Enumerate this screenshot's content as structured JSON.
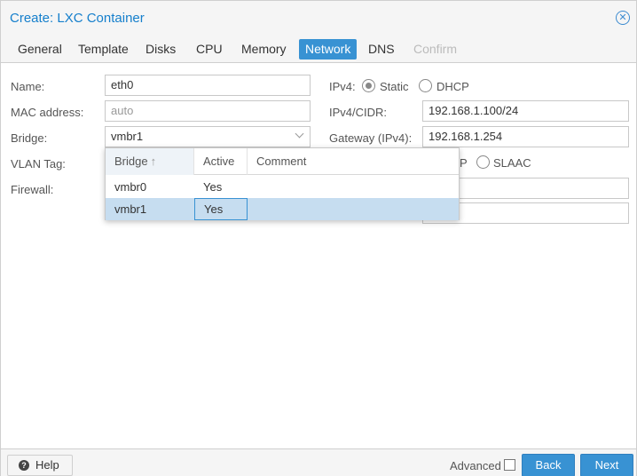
{
  "window": {
    "title": "Create: LXC Container"
  },
  "tabs": [
    {
      "label": "General"
    },
    {
      "label": "Template"
    },
    {
      "label": "Disks"
    },
    {
      "label": "CPU"
    },
    {
      "label": "Memory"
    },
    {
      "label": "Network",
      "active": true
    },
    {
      "label": "DNS"
    },
    {
      "label": "Confirm",
      "disabled": true
    }
  ],
  "form_left": {
    "name_label": "Name:",
    "name_value": "eth0",
    "mac_label": "MAC address:",
    "mac_placeholder": "auto",
    "bridge_label": "Bridge:",
    "bridge_value": "vmbr1",
    "vlan_label": "VLAN Tag:",
    "firewall_label": "Firewall:"
  },
  "form_right": {
    "ipv4_label": "IPv4:",
    "static_label": "Static",
    "dhcp_label": "DHCP",
    "ipv4_selected": "Static",
    "cidr_label": "IPv4/CIDR:",
    "cidr_value": "192.168.1.100/24",
    "gateway_label": "Gateway (IPv4):",
    "gateway_value": "192.168.1.254",
    "ipv6_partial_label": "P",
    "slaac_label": "SLAAC"
  },
  "bridge_dropdown": {
    "columns": [
      "Bridge",
      "Active",
      "Comment"
    ],
    "sort_icon": "sort-asc-icon",
    "rows": [
      {
        "bridge": "vmbr0",
        "active": "Yes",
        "comment": ""
      },
      {
        "bridge": "vmbr1",
        "active": "Yes",
        "comment": "",
        "selected": true
      }
    ]
  },
  "footer": {
    "help_label": "Help",
    "advanced_label": "Advanced",
    "back_label": "Back",
    "next_label": "Next"
  },
  "colors": {
    "accent": "#3892d3",
    "title": "#157fcc",
    "row_selected": "#c6ddf0"
  }
}
